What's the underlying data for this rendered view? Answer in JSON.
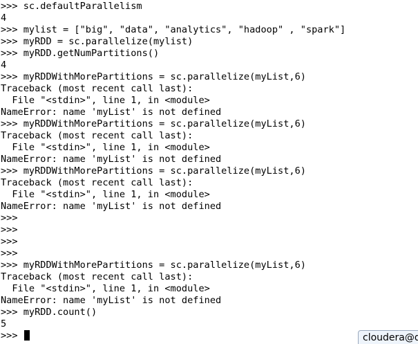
{
  "colors": {
    "background": "#ffffff",
    "text": "#000000",
    "cursor": "#000000",
    "tooltip_background": "#eef4fb",
    "tooltip_border": "#9aa9bd"
  },
  "terminal": {
    "lines": [
      ">>> sc.defaultParallelism",
      "4",
      ">>> mylist = [\"big\", \"data\", \"analytics\", \"hadoop\" , \"spark\"]",
      ">>> myRDD = sc.parallelize(mylist)",
      ">>> myRDD.getNumPartitions()",
      "4",
      ">>> myRDDWithMorePartitions = sc.parallelize(myList,6)",
      "Traceback (most recent call last):",
      "  File \"<stdin>\", line 1, in <module>",
      "NameError: name 'myList' is not defined",
      ">>> myRDDWithMorePartitions = sc.parallelize(myList,6)",
      "Traceback (most recent call last):",
      "  File \"<stdin>\", line 1, in <module>",
      "NameError: name 'myList' is not defined",
      ">>> myRDDWithMorePartitions = sc.parallelize(myList,6)",
      "Traceback (most recent call last):",
      "  File \"<stdin>\", line 1, in <module>",
      "NameError: name 'myList' is not defined",
      ">>>",
      ">>>",
      ">>>",
      ">>>",
      ">>> myRDDWithMorePartitions = sc.parallelize(myList,6)",
      "Traceback (most recent call last):",
      "  File \"<stdin>\", line 1, in <module>",
      "NameError: name 'myList' is not defined",
      ">>> myRDD.count()",
      "5"
    ],
    "prompt": ">>> "
  },
  "tooltip": {
    "text": "cloudera@q"
  }
}
